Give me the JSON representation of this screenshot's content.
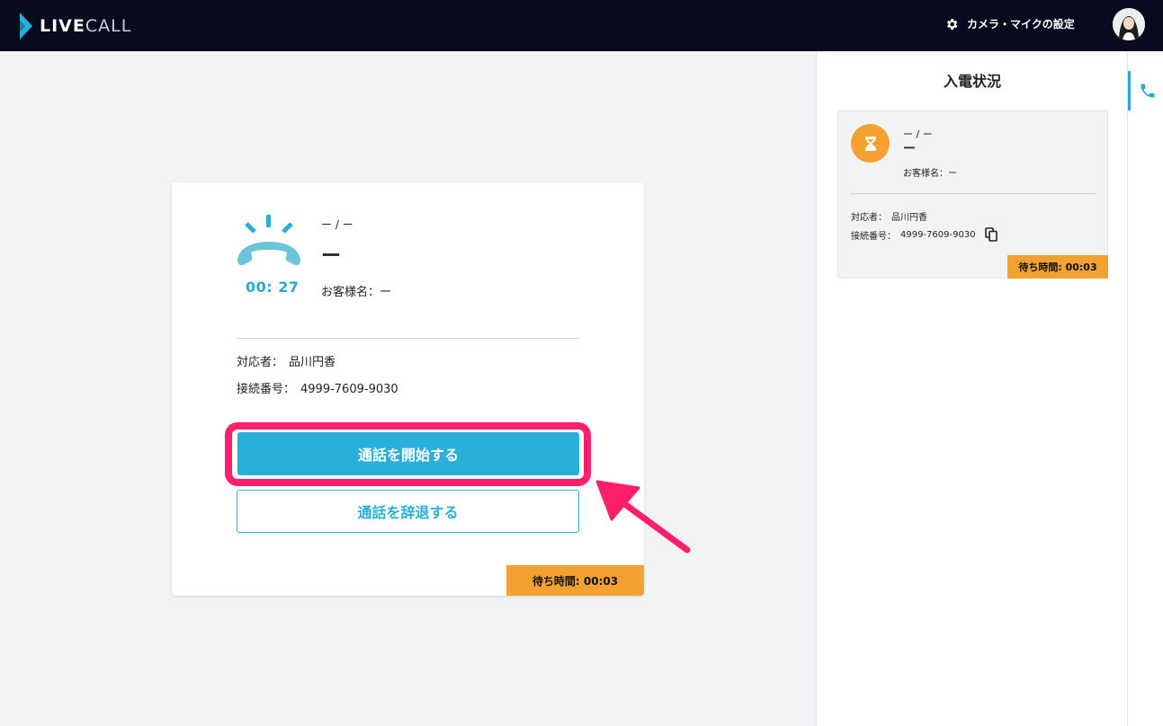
{
  "app": {
    "logo_live": "LIVE",
    "logo_call": "CALL"
  },
  "header": {
    "settings_label": "カメラ・マイクの設定"
  },
  "call_card": {
    "timer": "00: 27",
    "sub_title": "ー / ー",
    "main_title": "ー",
    "customer_label": "お客様名：",
    "customer_value": "ー",
    "agent_label": "対応者：",
    "agent_value": "品川円香",
    "number_label": "接続番号：",
    "number_value": "4999-7609-9030",
    "start_button": "通話を開始する",
    "decline_button": "通話を辞退する",
    "wait_label": "待ち時間: 00:03"
  },
  "incoming_panel": {
    "title": "入電状況",
    "sub_title": "ー / ー",
    "main_title": "ー",
    "customer_text": "お客様名：ー",
    "agent_label": "対応者：",
    "agent_value": "品川円香",
    "number_label": "接続番号：",
    "number_value": "4999-7609-9030",
    "wait_label": "待ち時間: 00:03"
  },
  "icons": [
    "gear-icon",
    "avatar",
    "ringing-phone-icon",
    "hourglass-icon",
    "copy-icon",
    "phone-icon",
    "arrow-pointer"
  ],
  "colors": {
    "header_bg": "#070b1d",
    "accent": "#2aafd9",
    "wait_badge": "#f3a231",
    "highlight": "#ff1f6a"
  }
}
